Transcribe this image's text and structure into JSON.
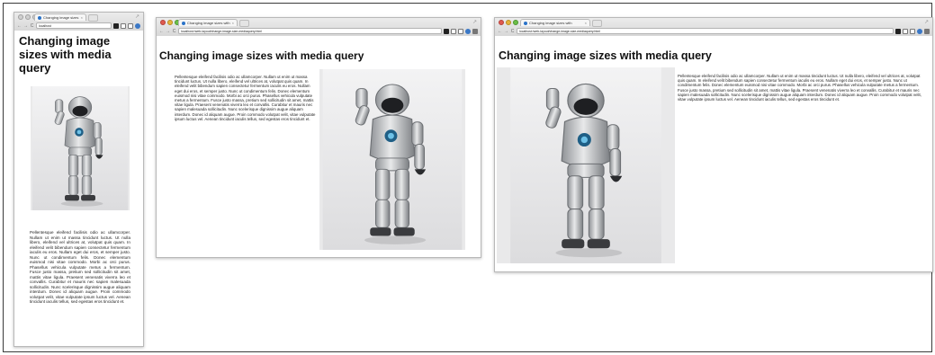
{
  "tab_title": "Changing image sizes with",
  "tab_close": "×",
  "nav_back": "←",
  "nav_forward": "→",
  "nav_reload": "C",
  "url_short": "localhost",
  "url_full": "localhost:/web-layout/change-image-size-mediaquery.html",
  "resize_glyph": "↗",
  "heading": "Changing image sizes with media query",
  "paragraph": "Pellentesque eleifend facilisis odio ac ullamcorper. Nullam ut enim ut massa tincidunt luctus. Ut nulla libero, eleifend vel ultrices at, volutpat quis quam. In eleifend velit bibendum sapien consectetur fermentum iaculis eu eros. Nullam eget dui eros, et semper justo. Nunc ut condimentum felis. Donec elementum euismod nisi vitae commodo. Morbi ac orci purus. Phasellus vehicula vulputate metus a fermentum. Fusce justo massa, pretium sed sollicitudin sit amet, mattis vitae ligula. Praesent venenatis viverra leo et convallis. Curabitur et mauris nec sapien malesuada sollicitudin. Nunc scelerisque dignissim augue aliquam interdum. Donec id aliquam augue. Proin commodo volutpat velit, vitae vulputate ipsum luctus vel. Aenean tincidunt iaculis tellus, sed egestas eros tincidunt et.",
  "image_subject": "robot-photo"
}
